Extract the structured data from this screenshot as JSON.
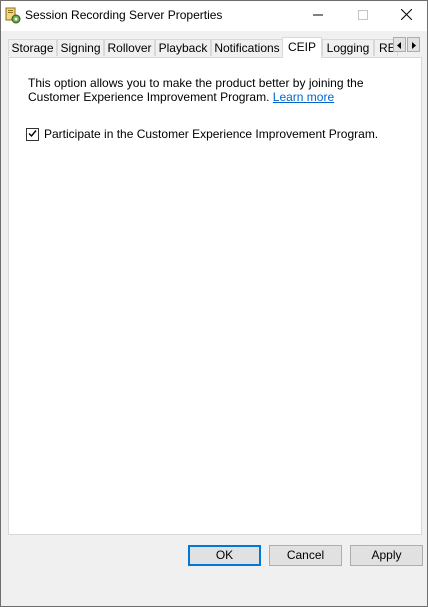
{
  "window": {
    "title": "Session Recording Server Properties",
    "icon": "session-recording-app-icon"
  },
  "caption": {
    "minimize_icon": "minimize-icon",
    "maximize_icon": "maximize-icon",
    "close_icon": "close-icon"
  },
  "tabs": [
    {
      "label": "Storage"
    },
    {
      "label": "Signing"
    },
    {
      "label": "Rollover"
    },
    {
      "label": "Playback"
    },
    {
      "label": "Notifications"
    },
    {
      "label": "CEIP",
      "active": true
    },
    {
      "label": "Logging"
    },
    {
      "label": "RE"
    }
  ],
  "tab_scroll": {
    "left": "◂",
    "right": "▸"
  },
  "ceip": {
    "description": "This option allows you to make the product better by joining the Customer Experience Improvement Program.",
    "learn_more": "Learn more",
    "checkbox_label": "Participate in the Customer Experience Improvement Program.",
    "checked": true
  },
  "buttons": {
    "ok": "OK",
    "cancel": "Cancel",
    "apply": "Apply"
  },
  "colors": {
    "accent": "#0078d7",
    "link": "#0066cc"
  }
}
